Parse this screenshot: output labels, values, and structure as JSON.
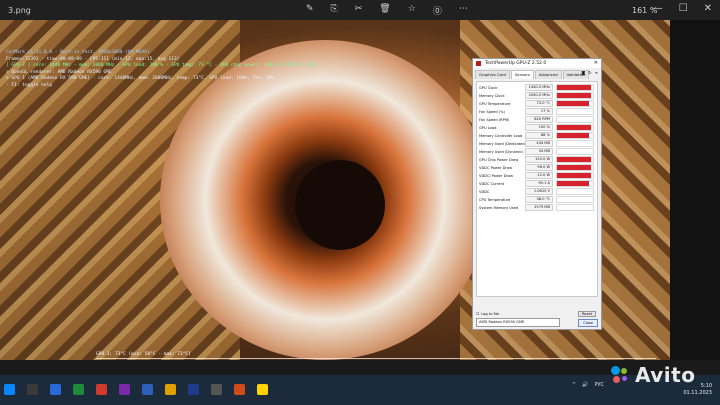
{
  "viewer": {
    "file_name": "3.png",
    "zoom": "161 %",
    "tools": [
      "✎",
      "⎘",
      "✂",
      "🗑",
      "☆",
      "⓪",
      "⋯"
    ],
    "window_controls": [
      "—",
      "☐",
      "✕"
    ]
  },
  "overlay": {
    "lines": [
      "FurMark v1.31.0.0 - Burn-in test, 1920x1080 (0X MSAA)",
      "Frames:71391 - time:00:09:09 - FPS:111 (min:12, max:15, avg:113)",
      "[ GPU-Z ] core: 1440 MHz - mem: 2000 MHz - GPU load: 100 % - GPU temp: 73 °C - GPU chip power: 120.0 W (PPW: 0.924)",
      "> OpenGL renderer: AMD Radeon RX590 GME",
      "> GPU 1 (AMD Radeon RX 590 GME) - core: 1440MHz, mem: 2000MHz, temp: 73°C, GPU load: 100%, fan: 40%",
      "- F1: toggle help"
    ],
    "bottom_label": "GPU 1: 73°C (min: 50°C - max: 73°C)"
  },
  "gpuz": {
    "title": "TechPowerUp GPU-Z 2.52.0",
    "tabs": [
      "Graphics Card",
      "Sensors",
      "Advanced",
      "Validation"
    ],
    "active_tab": "Sensors",
    "icons": [
      "camera-icon",
      "refresh-icon",
      "menu-icon"
    ],
    "sensors": [
      {
        "label": "GPU Clock",
        "value": "1440.0 MHz",
        "level": 0.95
      },
      {
        "label": "Memory Clock",
        "value": "2000.0 MHz",
        "level": 0.95
      },
      {
        "label": "GPU Temperature",
        "value": "73.0 °C",
        "level": 0.9
      },
      {
        "label": "Fan Speed (%)",
        "value": "17 %",
        "level": 0.0
      },
      {
        "label": "Fan Speed (RPM)",
        "value": "820 RPM",
        "level": 0.0
      },
      {
        "label": "GPU Load",
        "value": "100 %",
        "level": 0.95
      },
      {
        "label": "Memory Controller Load",
        "value": "88 %",
        "level": 0.9
      },
      {
        "label": "Memory Used (Dedicated)",
        "value": "434 MB",
        "level": 0.0
      },
      {
        "label": "Memory Used (Dynamic)",
        "value": "54 MB",
        "level": 0.0
      },
      {
        "label": "GPU Chip Power Draw",
        "value": "120.0 W",
        "level": 0.95
      },
      {
        "label": "VDDC Power Draw",
        "value": "96.0 W",
        "level": 0.95
      },
      {
        "label": "VDDCI Power Draw",
        "value": "12.0 W",
        "level": 0.95
      },
      {
        "label": "VDDC Current",
        "value": "90.1 A",
        "level": 0.9
      },
      {
        "label": "VDDC",
        "value": "1.0625 V",
        "level": 0.0
      },
      {
        "label": "CPU Temperature",
        "value": "38.0 °C",
        "level": 0.0
      },
      {
        "label": "System Memory Used",
        "value": "2579 MB",
        "level": 0.0
      }
    ],
    "log_label": "Log to file",
    "reset_label": "Reset",
    "device": "AMD Radeon RX590 GME",
    "close_label": "Close"
  },
  "taskbar": {
    "app_colors": [
      "#0a84ff",
      "#3a3a3a",
      "#2a6ad8",
      "#1f8a3a",
      "#d23b2b",
      "#7a2aa8",
      "#2b5fb8",
      "#e0a000",
      "#1e3c8a",
      "#555555",
      "#d04a1a",
      "#ffd400"
    ],
    "tray_text": [
      "^",
      "🔊",
      "РУС"
    ],
    "time": "5:10",
    "date": "01.11.2023"
  },
  "watermark": {
    "text": "Avito",
    "dot_colors": [
      "#00aaff",
      "#97cf26",
      "#ff6163",
      "#a169f7"
    ]
  }
}
